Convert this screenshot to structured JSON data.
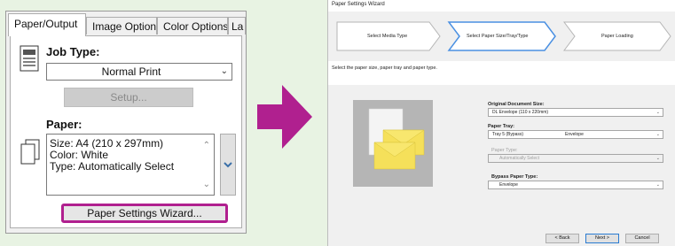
{
  "left_panel": {
    "tabs": [
      "Paper/Output",
      "Image Options",
      "Color Options",
      "La"
    ],
    "job_type": {
      "label": "Job Type:",
      "value": "Normal Print",
      "setup_button": "Setup..."
    },
    "paper": {
      "label": "Paper:",
      "lines": [
        "Size: A4 (210 x 297mm)",
        "Color: White",
        "Type: Automatically Select"
      ]
    },
    "wizard_button": "Paper Settings Wizard..."
  },
  "colors": {
    "background": "#e8f3e3",
    "arrow": "#b0208f",
    "highlight_border": "#b0208f",
    "active_step_border": "#4a90e2",
    "envelope_fill": "#f5e05a"
  },
  "dialog": {
    "title": "Paper Settings Wizard",
    "steps": [
      "Select Media Type",
      "Select Paper Size/Tray/Type",
      "Paper Loading"
    ],
    "active_step_index": 1,
    "message": "Select the paper size, paper tray and paper type.",
    "original_size": {
      "label": "Original Document Size:",
      "value": "DL Envelope (110 x 220mm)"
    },
    "paper_tray": {
      "label": "Paper Tray:",
      "value": "Tray 5 (Bypass)",
      "value2": "Envelope"
    },
    "paper_type": {
      "label": "Paper Type:",
      "value": "Automatically Select"
    },
    "bypass_type": {
      "label": "Bypass Paper Type:",
      "value": "Envelope"
    },
    "buttons": {
      "back": "< Back",
      "next": "Next >",
      "cancel": "Cancel"
    }
  }
}
